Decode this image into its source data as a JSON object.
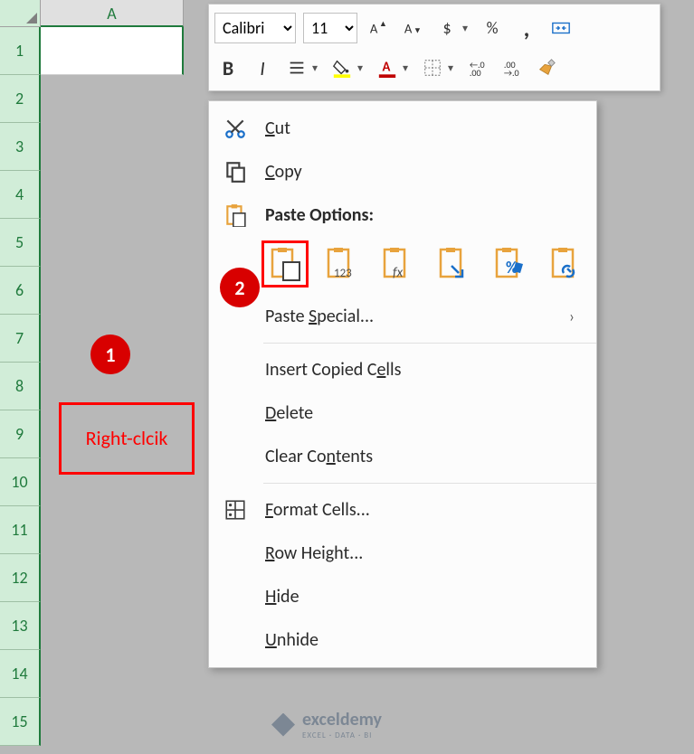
{
  "sheet": {
    "column_label": "A",
    "row_labels": [
      "1",
      "2",
      "3",
      "4",
      "5",
      "6",
      "7",
      "8",
      "9",
      "10",
      "11",
      "12",
      "13",
      "14",
      "15"
    ]
  },
  "toolbar": {
    "font_name": "Calibri",
    "font_size": "11",
    "bold": "B",
    "italic": "I",
    "currency_symbol": "$",
    "percent": "%",
    "comma": ","
  },
  "context_menu": {
    "cut": "Cut",
    "copy": "Copy",
    "paste_options_header": "Paste Options:",
    "paste_special": "Paste Special...",
    "insert_copied": "Insert Copied Cells",
    "delete": "Delete",
    "clear_contents": "Clear Contents",
    "format_cells": "Format Cells...",
    "row_height": "Row Height...",
    "hide": "Hide",
    "unhide": "Unhide",
    "paste_icon_labels": {
      "paste": "paste",
      "values": "123",
      "formulas": "fx",
      "transpose": "transpose",
      "formatting": "formatting",
      "link": "link"
    }
  },
  "annotations": {
    "step1_label": "Right-clcik",
    "badge1": "1",
    "badge2": "2"
  },
  "watermark": {
    "name": "exceldemy",
    "sub": "EXCEL · DATA · BI"
  }
}
